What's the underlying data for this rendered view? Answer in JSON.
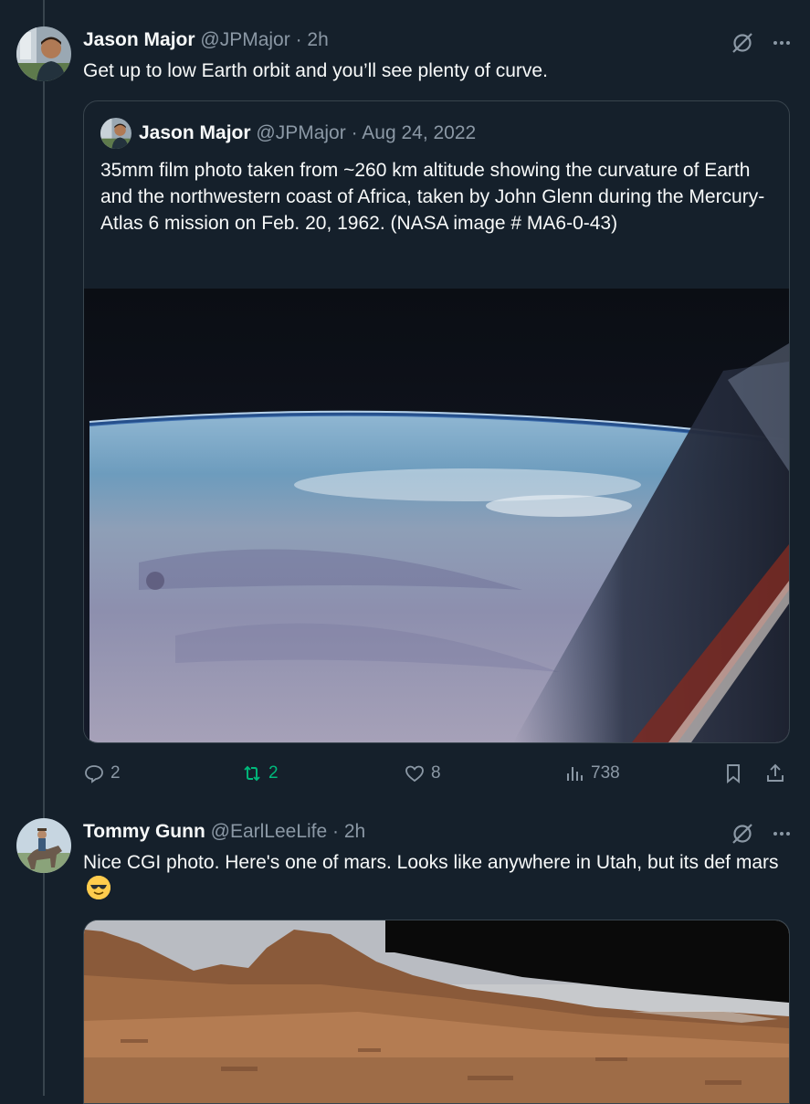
{
  "tweet1": {
    "name": "Jason Major",
    "handle": "@JPMajor",
    "dot": "·",
    "time": "2h",
    "text": "Get up to low Earth orbit and you’ll see plenty of curve.",
    "quote": {
      "name": "Jason Major",
      "handle": "@JPMajor",
      "dot": "·",
      "date": "Aug 24, 2022",
      "text": "35mm film photo taken from ~260 km altitude showing the curvature of Earth and the northwestern coast of Africa, taken by John Glenn during the Mercury-Atlas 6 mission on Feb. 20, 1962. (NASA image # MA6-0-43)"
    },
    "actions": {
      "replies": "2",
      "reposts": "2",
      "likes": "8",
      "views": "738"
    }
  },
  "tweet2": {
    "name": "Tommy Gunn",
    "handle": "@EarlLeeLife",
    "dot": "·",
    "time": "2h",
    "text": "Nice CGI photo. Here's one of mars. Looks like anywhere in Utah, but its def mars"
  },
  "icons": {
    "grok": "grok-icon",
    "more": "more-icon",
    "reply": "reply-icon",
    "repost": "repost-icon",
    "like": "like-icon",
    "views": "views-icon",
    "bookmark": "bookmark-icon",
    "share": "share-icon",
    "emoji": "sunglasses-emoji-icon"
  },
  "colors": {
    "background": "#15202b",
    "text": "#f7f9f9",
    "muted": "#8b98a5",
    "border": "#38444d",
    "repost_green": "#00ba7c"
  }
}
